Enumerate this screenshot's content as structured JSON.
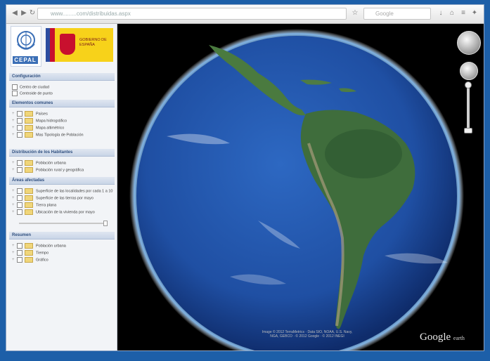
{
  "browser": {
    "url": "www.........com/distribuidas.aspx",
    "search_placeholder": "Google",
    "icons": [
      "back-icon",
      "forward-icon",
      "reload-icon",
      "home-icon",
      "star-icon",
      "menu-icon"
    ]
  },
  "sidebar": {
    "un_label": "CEPAL",
    "spain_label": "GOBIERNO DE ESPAÑA",
    "sections": [
      {
        "title": "Configuración",
        "items": [
          "Centro de ciudad",
          "Centroide de punto"
        ]
      },
      {
        "title": "Elementos comunes",
        "items": [
          "Países",
          "Mapa hidrográfico",
          "Mapa altimétrico",
          "Mas Tipología de Población"
        ]
      },
      {
        "title": "Distribución de los Habitantes",
        "items": [
          "Población urbana",
          "Población rural y geográfica"
        ]
      },
      {
        "title": "Áreas afectadas",
        "items": [
          "Superficie de las localidades por cada 1 a 10",
          "Superficie de las tierras por mayo",
          "Tierra plana",
          "Ubicación de la vivienda por mayo"
        ]
      },
      {
        "title": "Resumen",
        "items": [
          "Población urbana",
          "Tiempo",
          "Gráfico"
        ]
      }
    ]
  },
  "map": {
    "attribution": "Image © 2012 TerraMetrics · Data SIO, NOAA, U.S. Navy, NGA, GEBCO · © 2012 Google · © 2012 INEGI",
    "brand": "Google",
    "brand_sub": "earth",
    "colors": {
      "ocean": "#1f4fa3",
      "land": "#3f6d3c",
      "space": "#000000"
    }
  }
}
